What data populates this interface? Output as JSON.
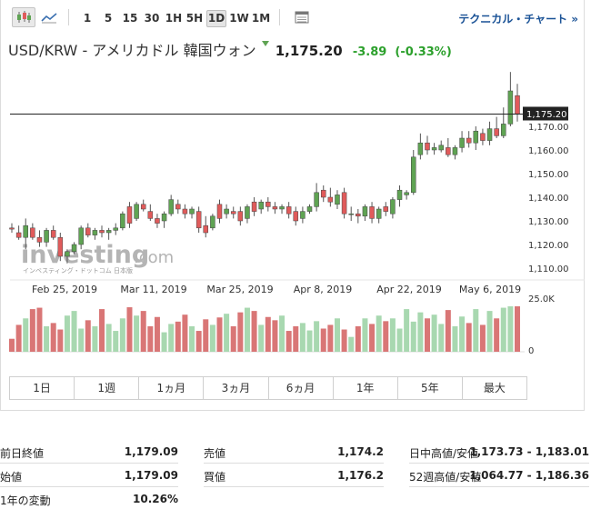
{
  "toolbar": {
    "icons": [
      "candlestick-chart-icon",
      "area-chart-icon",
      "calendar-table-icon"
    ],
    "timeframes": [
      "1",
      "5",
      "15",
      "30",
      "1H",
      "5H",
      "1D",
      "1W",
      "1M"
    ],
    "active_timeframe": "1D",
    "tech_chart_link": "テクニカル・チャート »"
  },
  "quote": {
    "name": "USD/KRW - アメリカドル 韓国ウォン",
    "price": "1,175.20",
    "change": "-3.89",
    "change_pct": "(-0.33%)",
    "colors": {
      "up": "#5fa353",
      "down": "#e05b5b",
      "volume_up": "#a8d8b0",
      "volume_down": "#d97676"
    }
  },
  "watermark": {
    "brand": "investing",
    "suffix": ".com",
    "tagline": "インベスティング・ドットコム 日本版"
  },
  "chart_data": {
    "type": "candlestick",
    "x_labels": [
      "Feb 25, 2019",
      "Mar 11, 2019",
      "Mar 25, 2019",
      "Apr 8, 2019",
      "Apr 22, 2019",
      "May 6, 2019"
    ],
    "y_ticks": [
      "1,110.00",
      "1,120.00",
      "1,130.00",
      "1,140.00",
      "1,150.00",
      "1,160.00",
      "1,170.00"
    ],
    "ylim": [
      1105,
      1195
    ],
    "last_price_label": "1,175.20",
    "volume_axis": {
      "max_label": "25.0K",
      "min_label": "0"
    },
    "candles": [
      {
        "o": 1127,
        "h": 1129,
        "l": 1125,
        "c": 1126.5
      },
      {
        "o": 1125,
        "h": 1128,
        "l": 1122,
        "c": 1123
      },
      {
        "o": 1123,
        "h": 1131,
        "l": 1118,
        "c": 1128
      },
      {
        "o": 1127,
        "h": 1129,
        "l": 1122,
        "c": 1123
      },
      {
        "o": 1123,
        "h": 1126,
        "l": 1119,
        "c": 1121
      },
      {
        "o": 1121,
        "h": 1127,
        "l": 1119,
        "c": 1126
      },
      {
        "o": 1126,
        "h": 1128,
        "l": 1122,
        "c": 1123
      },
      {
        "o": 1123,
        "h": 1125,
        "l": 1113,
        "c": 1115
      },
      {
        "o": 1115,
        "h": 1118,
        "l": 1112,
        "c": 1117
      },
      {
        "o": 1117,
        "h": 1121,
        "l": 1116,
        "c": 1120
      },
      {
        "o": 1120,
        "h": 1128,
        "l": 1118,
        "c": 1127
      },
      {
        "o": 1127,
        "h": 1129,
        "l": 1123,
        "c": 1124
      },
      {
        "o": 1124,
        "h": 1127,
        "l": 1122,
        "c": 1126
      },
      {
        "o": 1126,
        "h": 1128,
        "l": 1123,
        "c": 1125
      },
      {
        "o": 1125,
        "h": 1127,
        "l": 1122,
        "c": 1126
      },
      {
        "o": 1126,
        "h": 1129,
        "l": 1124,
        "c": 1127
      },
      {
        "o": 1127,
        "h": 1134,
        "l": 1126,
        "c": 1133
      },
      {
        "o": 1136,
        "h": 1138,
        "l": 1127,
        "c": 1129
      },
      {
        "o": 1131,
        "h": 1138,
        "l": 1130,
        "c": 1137
      },
      {
        "o": 1137,
        "h": 1139,
        "l": 1134,
        "c": 1135
      },
      {
        "o": 1134,
        "h": 1137,
        "l": 1130,
        "c": 1131
      },
      {
        "o": 1131,
        "h": 1133,
        "l": 1127,
        "c": 1129
      },
      {
        "o": 1130,
        "h": 1134,
        "l": 1127,
        "c": 1133
      },
      {
        "o": 1133,
        "h": 1141,
        "l": 1132,
        "c": 1139
      },
      {
        "o": 1137,
        "h": 1139,
        "l": 1133,
        "c": 1135
      },
      {
        "o": 1135,
        "h": 1137,
        "l": 1131,
        "c": 1133
      },
      {
        "o": 1133,
        "h": 1136,
        "l": 1131,
        "c": 1135
      },
      {
        "o": 1134,
        "h": 1136,
        "l": 1125,
        "c": 1127
      },
      {
        "o": 1128,
        "h": 1132,
        "l": 1123,
        "c": 1125
      },
      {
        "o": 1127,
        "h": 1133,
        "l": 1126,
        "c": 1132
      },
      {
        "o": 1137,
        "h": 1139,
        "l": 1129,
        "c": 1131
      },
      {
        "o": 1133,
        "h": 1137,
        "l": 1131,
        "c": 1135
      },
      {
        "o": 1134,
        "h": 1136,
        "l": 1131,
        "c": 1133
      },
      {
        "o": 1134,
        "h": 1136,
        "l": 1128,
        "c": 1130
      },
      {
        "o": 1131,
        "h": 1137,
        "l": 1129,
        "c": 1136
      },
      {
        "o": 1138,
        "h": 1140,
        "l": 1132,
        "c": 1134
      },
      {
        "o": 1135,
        "h": 1139,
        "l": 1133,
        "c": 1138
      },
      {
        "o": 1138,
        "h": 1140,
        "l": 1134,
        "c": 1136
      },
      {
        "o": 1136,
        "h": 1138,
        "l": 1133,
        "c": 1135
      },
      {
        "o": 1135,
        "h": 1137,
        "l": 1133,
        "c": 1136
      },
      {
        "o": 1136,
        "h": 1138,
        "l": 1131,
        "c": 1133
      },
      {
        "o": 1134,
        "h": 1136,
        "l": 1128,
        "c": 1130
      },
      {
        "o": 1131,
        "h": 1136,
        "l": 1129,
        "c": 1134
      },
      {
        "o": 1134,
        "h": 1137,
        "l": 1133,
        "c": 1136
      },
      {
        "o": 1136,
        "h": 1146,
        "l": 1134,
        "c": 1142
      },
      {
        "o": 1143,
        "h": 1145,
        "l": 1138,
        "c": 1140
      },
      {
        "o": 1140,
        "h": 1144,
        "l": 1136,
        "c": 1138
      },
      {
        "o": 1137,
        "h": 1143,
        "l": 1135,
        "c": 1141
      },
      {
        "o": 1142,
        "h": 1144,
        "l": 1131,
        "c": 1133
      },
      {
        "o": 1133,
        "h": 1136,
        "l": 1130,
        "c": 1133
      },
      {
        "o": 1133,
        "h": 1135,
        "l": 1129,
        "c": 1132
      },
      {
        "o": 1132,
        "h": 1137,
        "l": 1130,
        "c": 1136
      },
      {
        "o": 1136,
        "h": 1138,
        "l": 1129,
        "c": 1131
      },
      {
        "o": 1131,
        "h": 1136,
        "l": 1129,
        "c": 1135
      },
      {
        "o": 1136,
        "h": 1138,
        "l": 1132,
        "c": 1134
      },
      {
        "o": 1133,
        "h": 1140,
        "l": 1131,
        "c": 1139
      },
      {
        "o": 1139,
        "h": 1145,
        "l": 1136,
        "c": 1143
      },
      {
        "o": 1141,
        "h": 1143,
        "l": 1139,
        "c": 1142
      },
      {
        "o": 1142,
        "h": 1160,
        "l": 1141,
        "c": 1157
      },
      {
        "o": 1158,
        "h": 1167,
        "l": 1156,
        "c": 1163
      },
      {
        "o": 1163,
        "h": 1166,
        "l": 1158,
        "c": 1160
      },
      {
        "o": 1160,
        "h": 1163,
        "l": 1158,
        "c": 1161
      },
      {
        "o": 1160,
        "h": 1164,
        "l": 1159,
        "c": 1162
      },
      {
        "o": 1161,
        "h": 1165,
        "l": 1157,
        "c": 1158
      },
      {
        "o": 1158,
        "h": 1162,
        "l": 1156,
        "c": 1161
      },
      {
        "o": 1161,
        "h": 1168,
        "l": 1159,
        "c": 1165
      },
      {
        "o": 1165,
        "h": 1168,
        "l": 1161,
        "c": 1163
      },
      {
        "o": 1163,
        "h": 1170,
        "l": 1160,
        "c": 1168
      },
      {
        "o": 1167,
        "h": 1169,
        "l": 1162,
        "c": 1164
      },
      {
        "o": 1164,
        "h": 1172,
        "l": 1162,
        "c": 1169
      },
      {
        "o": 1169,
        "h": 1174,
        "l": 1165,
        "c": 1166
      },
      {
        "o": 1166,
        "h": 1178,
        "l": 1165,
        "c": 1171
      },
      {
        "o": 1171,
        "h": 1193,
        "l": 1170,
        "c": 1185
      },
      {
        "o": 1183,
        "h": 1188,
        "l": 1172,
        "c": 1175.2
      }
    ],
    "volumes": [
      0.28,
      0.58,
      0.72,
      0.92,
      0.95,
      0.55,
      0.62,
      0.48,
      0.78,
      0.88,
      0.5,
      0.68,
      0.55,
      0.92,
      0.6,
      0.45,
      0.72,
      0.96,
      0.78,
      0.88,
      0.55,
      0.75,
      0.42,
      0.6,
      0.65,
      0.8,
      0.55,
      0.45,
      0.7,
      0.58,
      0.74,
      0.82,
      0.55,
      0.85,
      0.95,
      0.88,
      0.58,
      0.75,
      0.68,
      0.78,
      0.45,
      0.55,
      0.62,
      0.46,
      0.66,
      0.5,
      0.58,
      0.72,
      0.48,
      0.32,
      0.55,
      0.72,
      0.6,
      0.78,
      0.66,
      0.72,
      0.5,
      0.92,
      0.65,
      0.85,
      0.72,
      0.8,
      0.6,
      0.9,
      0.55,
      0.76,
      0.62,
      0.92,
      0.58,
      0.88,
      0.72,
      0.95,
      0.98,
      0.98
    ]
  },
  "ranges": [
    "1日",
    "1週",
    "1ヵ月",
    "3ヵ月",
    "6ヵ月",
    "1年",
    "5年",
    "最大"
  ],
  "stats": {
    "prev_close_label": "前日終値",
    "prev_close": "1,179.09",
    "open_label": "始値",
    "open": "1,179.09",
    "year_change_label": "1年の変動",
    "year_change": "10.26%",
    "bid_label": "売値",
    "bid": "1,174.2",
    "ask_label": "買値",
    "ask": "1,176.2",
    "day_range_label": "日中高値/安値",
    "day_range": "1,173.73 - 1,183.01",
    "week52_label": "52週高値/安値",
    "week52": "1,064.77 - 1,186.36"
  }
}
